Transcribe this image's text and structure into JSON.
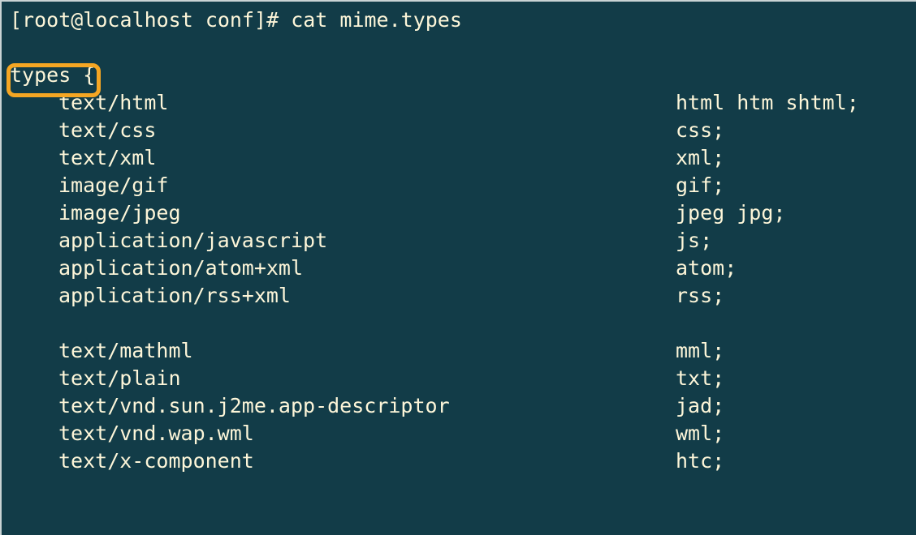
{
  "prompt": {
    "user_host": "[root@localhost conf]# ",
    "command": "cat mime.types"
  },
  "types_open": "types {",
  "rows_a": [
    {
      "mime": "text/html",
      "ext": "html htm shtml;"
    },
    {
      "mime": "text/css",
      "ext": "css;"
    },
    {
      "mime": "text/xml",
      "ext": "xml;"
    },
    {
      "mime": "image/gif",
      "ext": "gif;"
    },
    {
      "mime": "image/jpeg",
      "ext": "jpeg jpg;"
    },
    {
      "mime": "application/javascript",
      "ext": "js;"
    },
    {
      "mime": "application/atom+xml",
      "ext": "atom;"
    },
    {
      "mime": "application/rss+xml",
      "ext": "rss;"
    }
  ],
  "rows_b": [
    {
      "mime": "text/mathml",
      "ext": "mml;"
    },
    {
      "mime": "text/plain",
      "ext": "txt;"
    },
    {
      "mime": "text/vnd.sun.j2me.app-descriptor",
      "ext": "jad;"
    },
    {
      "mime": "text/vnd.wap.wml",
      "ext": "wml;"
    },
    {
      "mime": "text/x-component",
      "ext": "htc;"
    }
  ],
  "highlight_color": "#f5a623"
}
